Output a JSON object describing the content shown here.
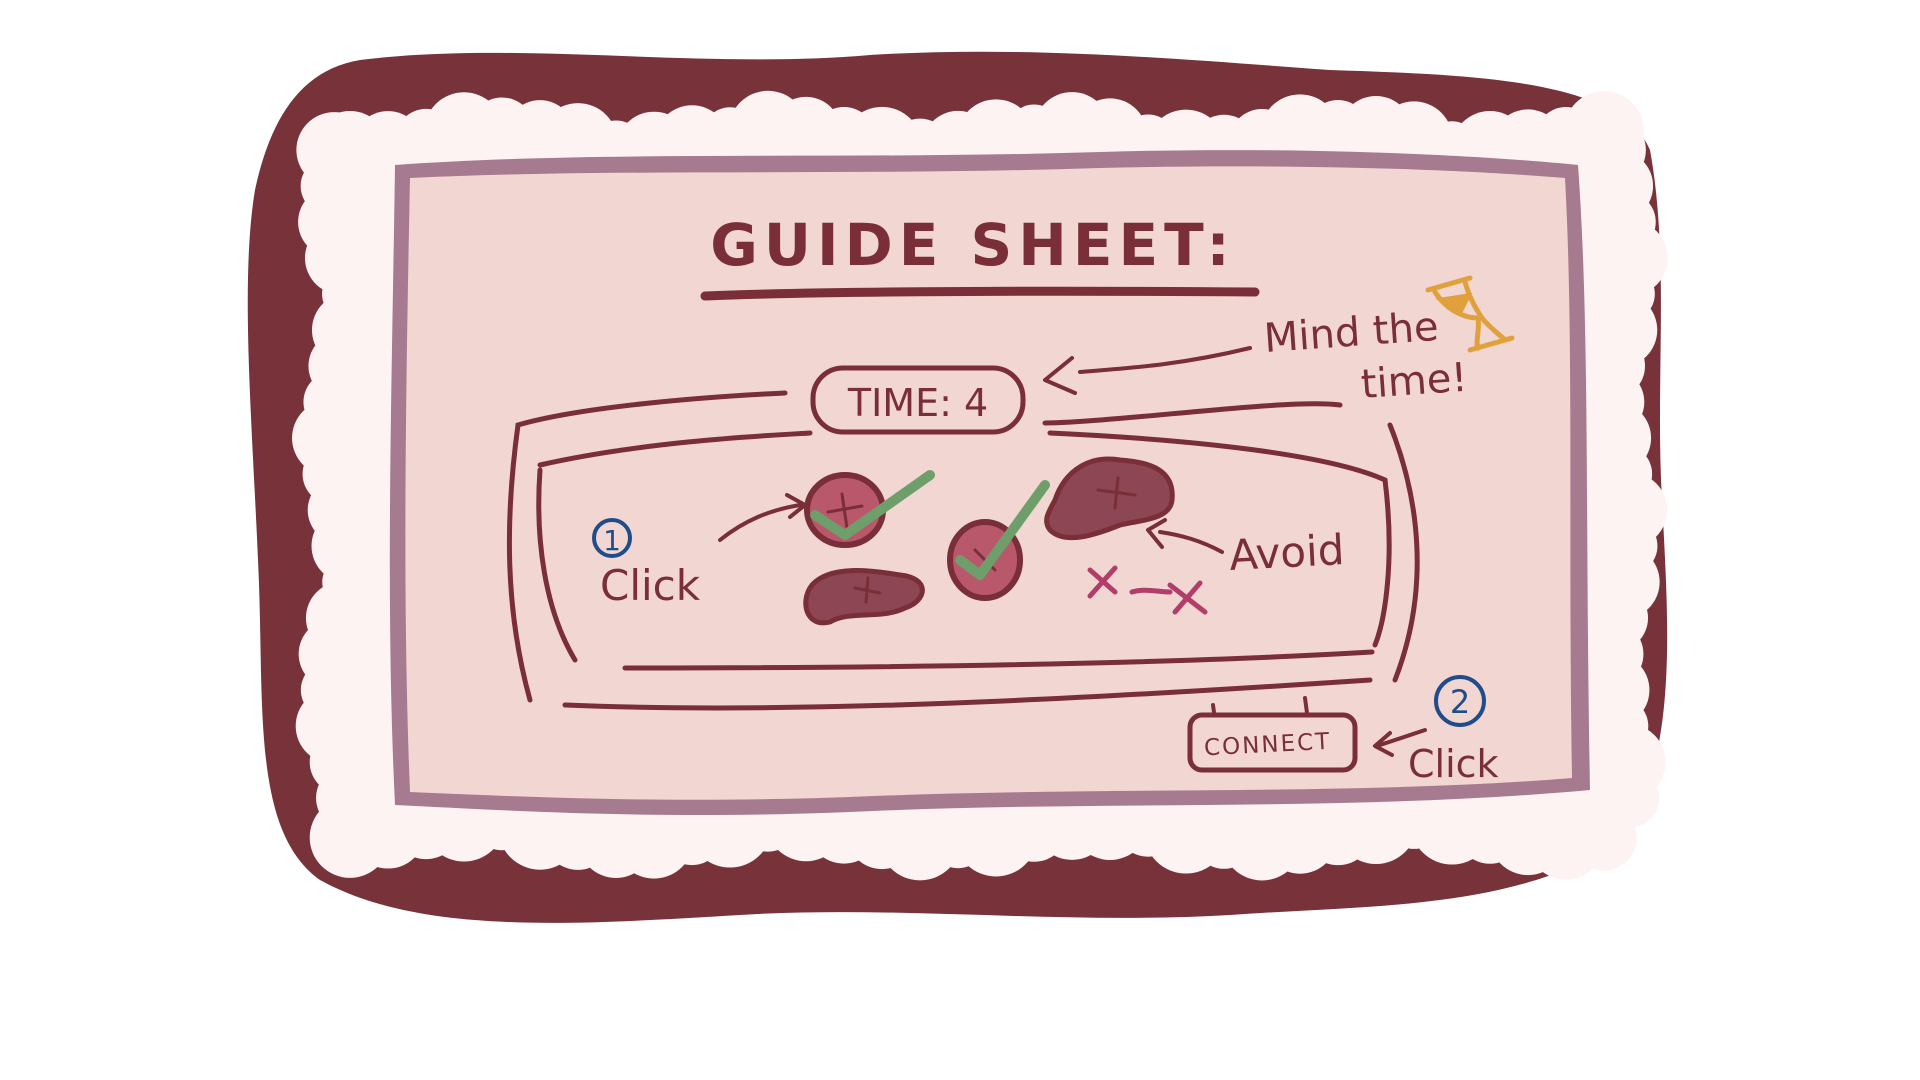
{
  "guide": {
    "title": "GUIDE SHEET:",
    "timer_label": "TIME: 4",
    "note_mind_line1": "Mind the",
    "note_mind_line2": "time!",
    "step1_number": "1",
    "step1_label": "Click",
    "avoid_label": "Avoid",
    "step2_number": "2",
    "step2_label": "Click",
    "connect_button": "CONNECT"
  },
  "icons": {
    "timer": "hourglass-icon",
    "correct": "checkmark-icon",
    "wrong": "x-mark-icon"
  },
  "colors": {
    "frame": "#773339",
    "paper": "#f1d6d2",
    "paper_edge": "#a77b8f",
    "cloud": "#fdf3f2",
    "ink": "#7a2e38",
    "target_fill": "#b8586a",
    "blob_fill": "#8d4653",
    "check": "#6e9f6b",
    "cross": "#b13d6a",
    "step_circle": "#204d8a",
    "hourglass": "#e0a03c"
  }
}
